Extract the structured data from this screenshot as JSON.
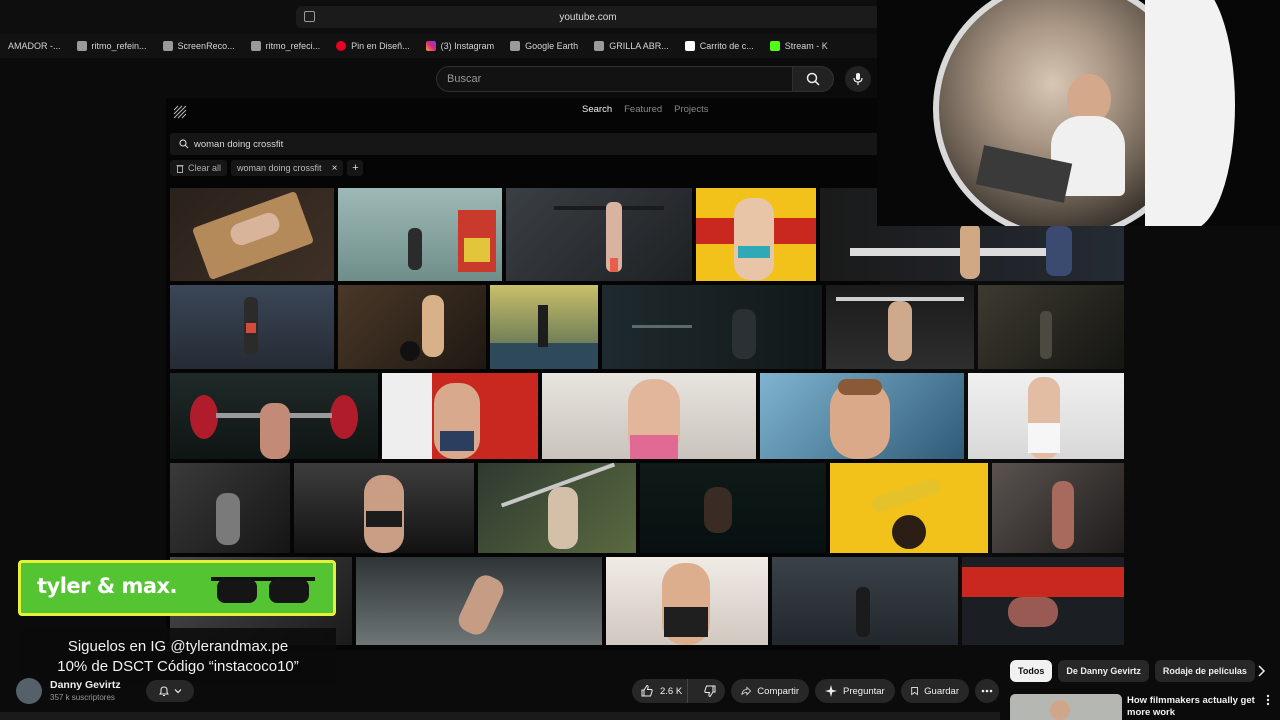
{
  "browser": {
    "url": "youtube.com",
    "bookmarks": [
      "AMADOR -...",
      "ritmo_refein...",
      "ScreenReco...",
      "ritmo_refeci...",
      "Pin en Diseñ...",
      "(3) Instagram",
      "Google Earth",
      "GRILLA ABR...",
      "Carrito de c...",
      "Stream - K"
    ]
  },
  "youtube": {
    "search_placeholder": "Buscar"
  },
  "app": {
    "nav": [
      "Search",
      "Featured",
      "Projects"
    ],
    "query": "woman doing crossfit",
    "clear_all": "Clear all",
    "tag": "woman doing crossfit",
    "add_filter": "+"
  },
  "promo": {
    "brand": "tyler & max.",
    "line1": "Siguelos en IG @tylerandmax.pe",
    "line2": "10% de DSCT Código “instacoco10”"
  },
  "channel": {
    "name": "Danny Gevirtz",
    "subscribers": "357 k suscriptores"
  },
  "actions": {
    "likes": "2.6 K",
    "share": "Compartir",
    "ask": "Preguntar",
    "save": "Guardar"
  },
  "side": {
    "chips": [
      "Todos",
      "De Danny Gevirtz",
      "Rodaje de películas"
    ],
    "rec_title": "How filmmakers actually get more work"
  },
  "colors": {
    "promo_green": "#55c433",
    "promo_border": "#e6f23a",
    "yellow_tile": "#f2c21a",
    "red_tile": "#c8281e"
  }
}
